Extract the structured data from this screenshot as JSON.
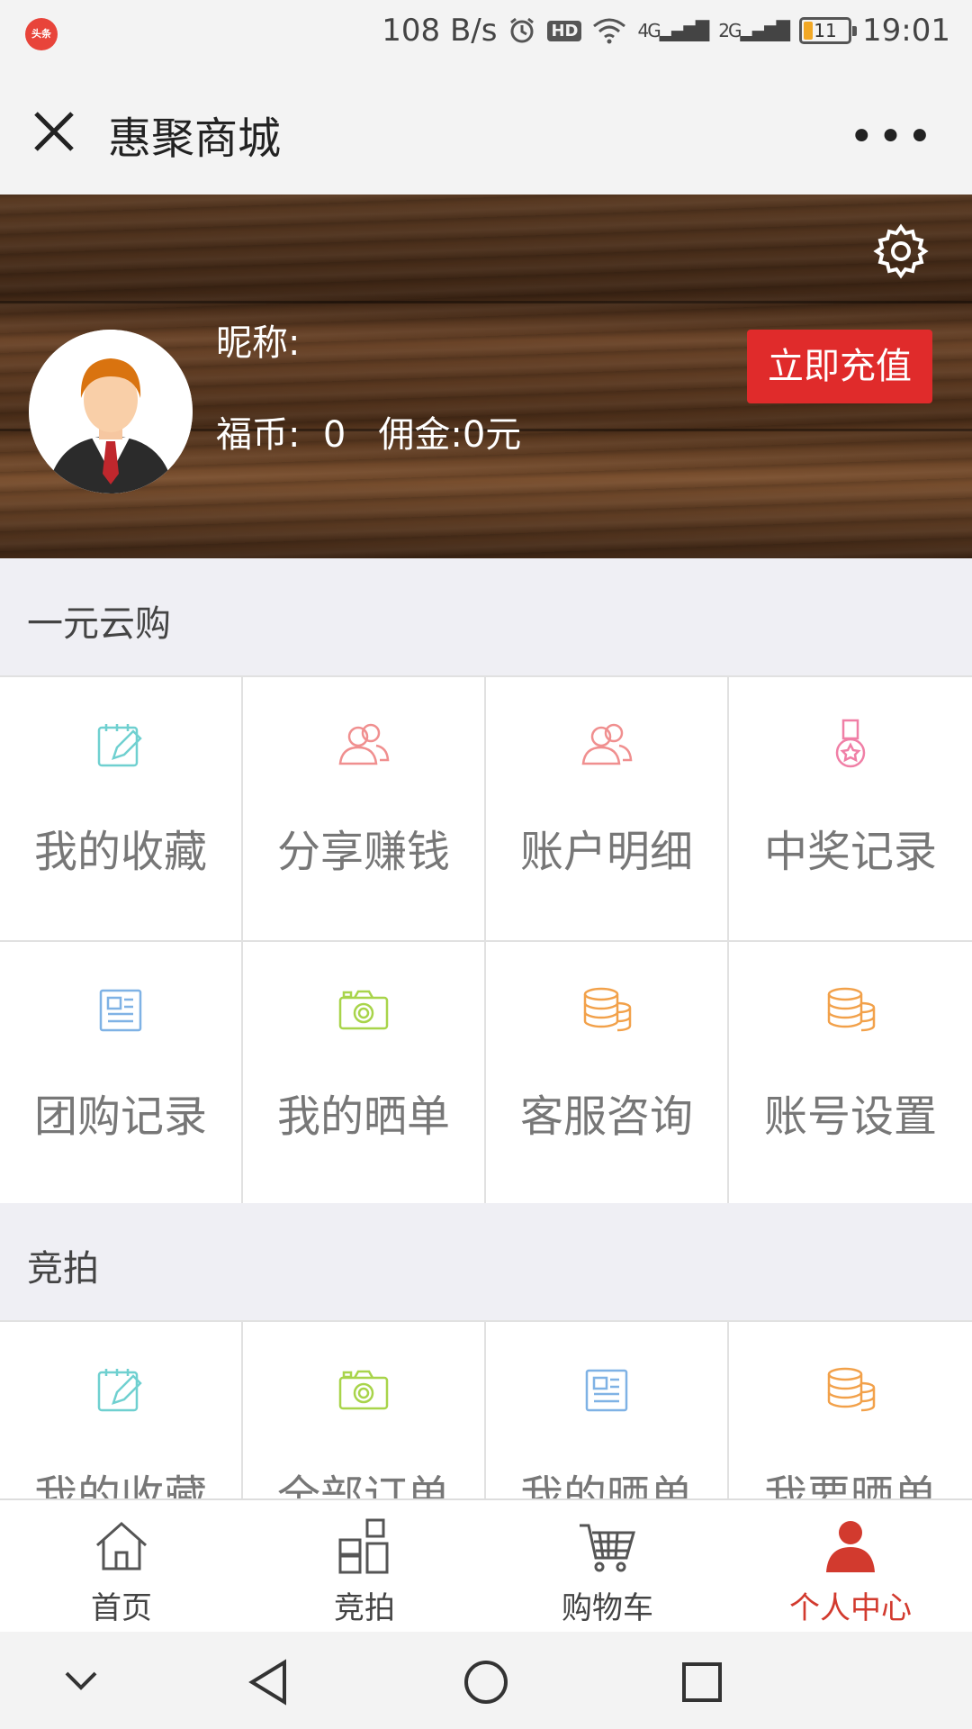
{
  "status_bar": {
    "app_badge": "头条",
    "net_speed": "108 B/s",
    "hd": "HD",
    "net1": "4G",
    "net2": "2G",
    "battery": "11",
    "time": "19:01"
  },
  "title_bar": {
    "title": "惠聚商城",
    "more": "•••"
  },
  "profile": {
    "nickname_label": "昵称:",
    "coins_label": "福币:",
    "coins_value": "0",
    "commission_label": "佣金:",
    "commission_value": "0元",
    "recharge_button": "立即充值"
  },
  "section1": {
    "title": "一元云购",
    "items": [
      {
        "label": "我的收藏",
        "icon": "edit-icon",
        "color": "#6fd0d0"
      },
      {
        "label": "分享赚钱",
        "icon": "users-icon",
        "color": "#f08f8f"
      },
      {
        "label": "账户明细",
        "icon": "users-icon",
        "color": "#f08f8f"
      },
      {
        "label": "中奖记录",
        "icon": "medal-icon",
        "color": "#f07fa6"
      },
      {
        "label": "团购记录",
        "icon": "document-icon",
        "color": "#7fb2e5"
      },
      {
        "label": "我的晒单",
        "icon": "camera-icon",
        "color": "#a8d44a"
      },
      {
        "label": "客服咨询",
        "icon": "coins-icon",
        "color": "#f2a14a"
      },
      {
        "label": "账号设置",
        "icon": "coins-icon",
        "color": "#f2a14a"
      }
    ]
  },
  "section2": {
    "title": "竞拍",
    "items": [
      {
        "label": "我的收藏",
        "icon": "edit-icon",
        "color": "#6fd0d0"
      },
      {
        "label": "全部订单",
        "icon": "camera-icon",
        "color": "#a8d44a"
      },
      {
        "label": "我的晒单",
        "icon": "document-icon",
        "color": "#7fb2e5"
      },
      {
        "label": "我要晒单",
        "icon": "coins-icon",
        "color": "#f2a14a"
      }
    ]
  },
  "tabbar": {
    "items": [
      {
        "label": "首页",
        "icon": "home-icon"
      },
      {
        "label": "竞拍",
        "icon": "grid-icon"
      },
      {
        "label": "购物车",
        "icon": "cart-icon"
      },
      {
        "label": "个人中心",
        "icon": "person-icon",
        "active": true
      }
    ]
  },
  "colors": {
    "accent": "#d23a2e",
    "recharge_bg": "#e02b2b"
  }
}
